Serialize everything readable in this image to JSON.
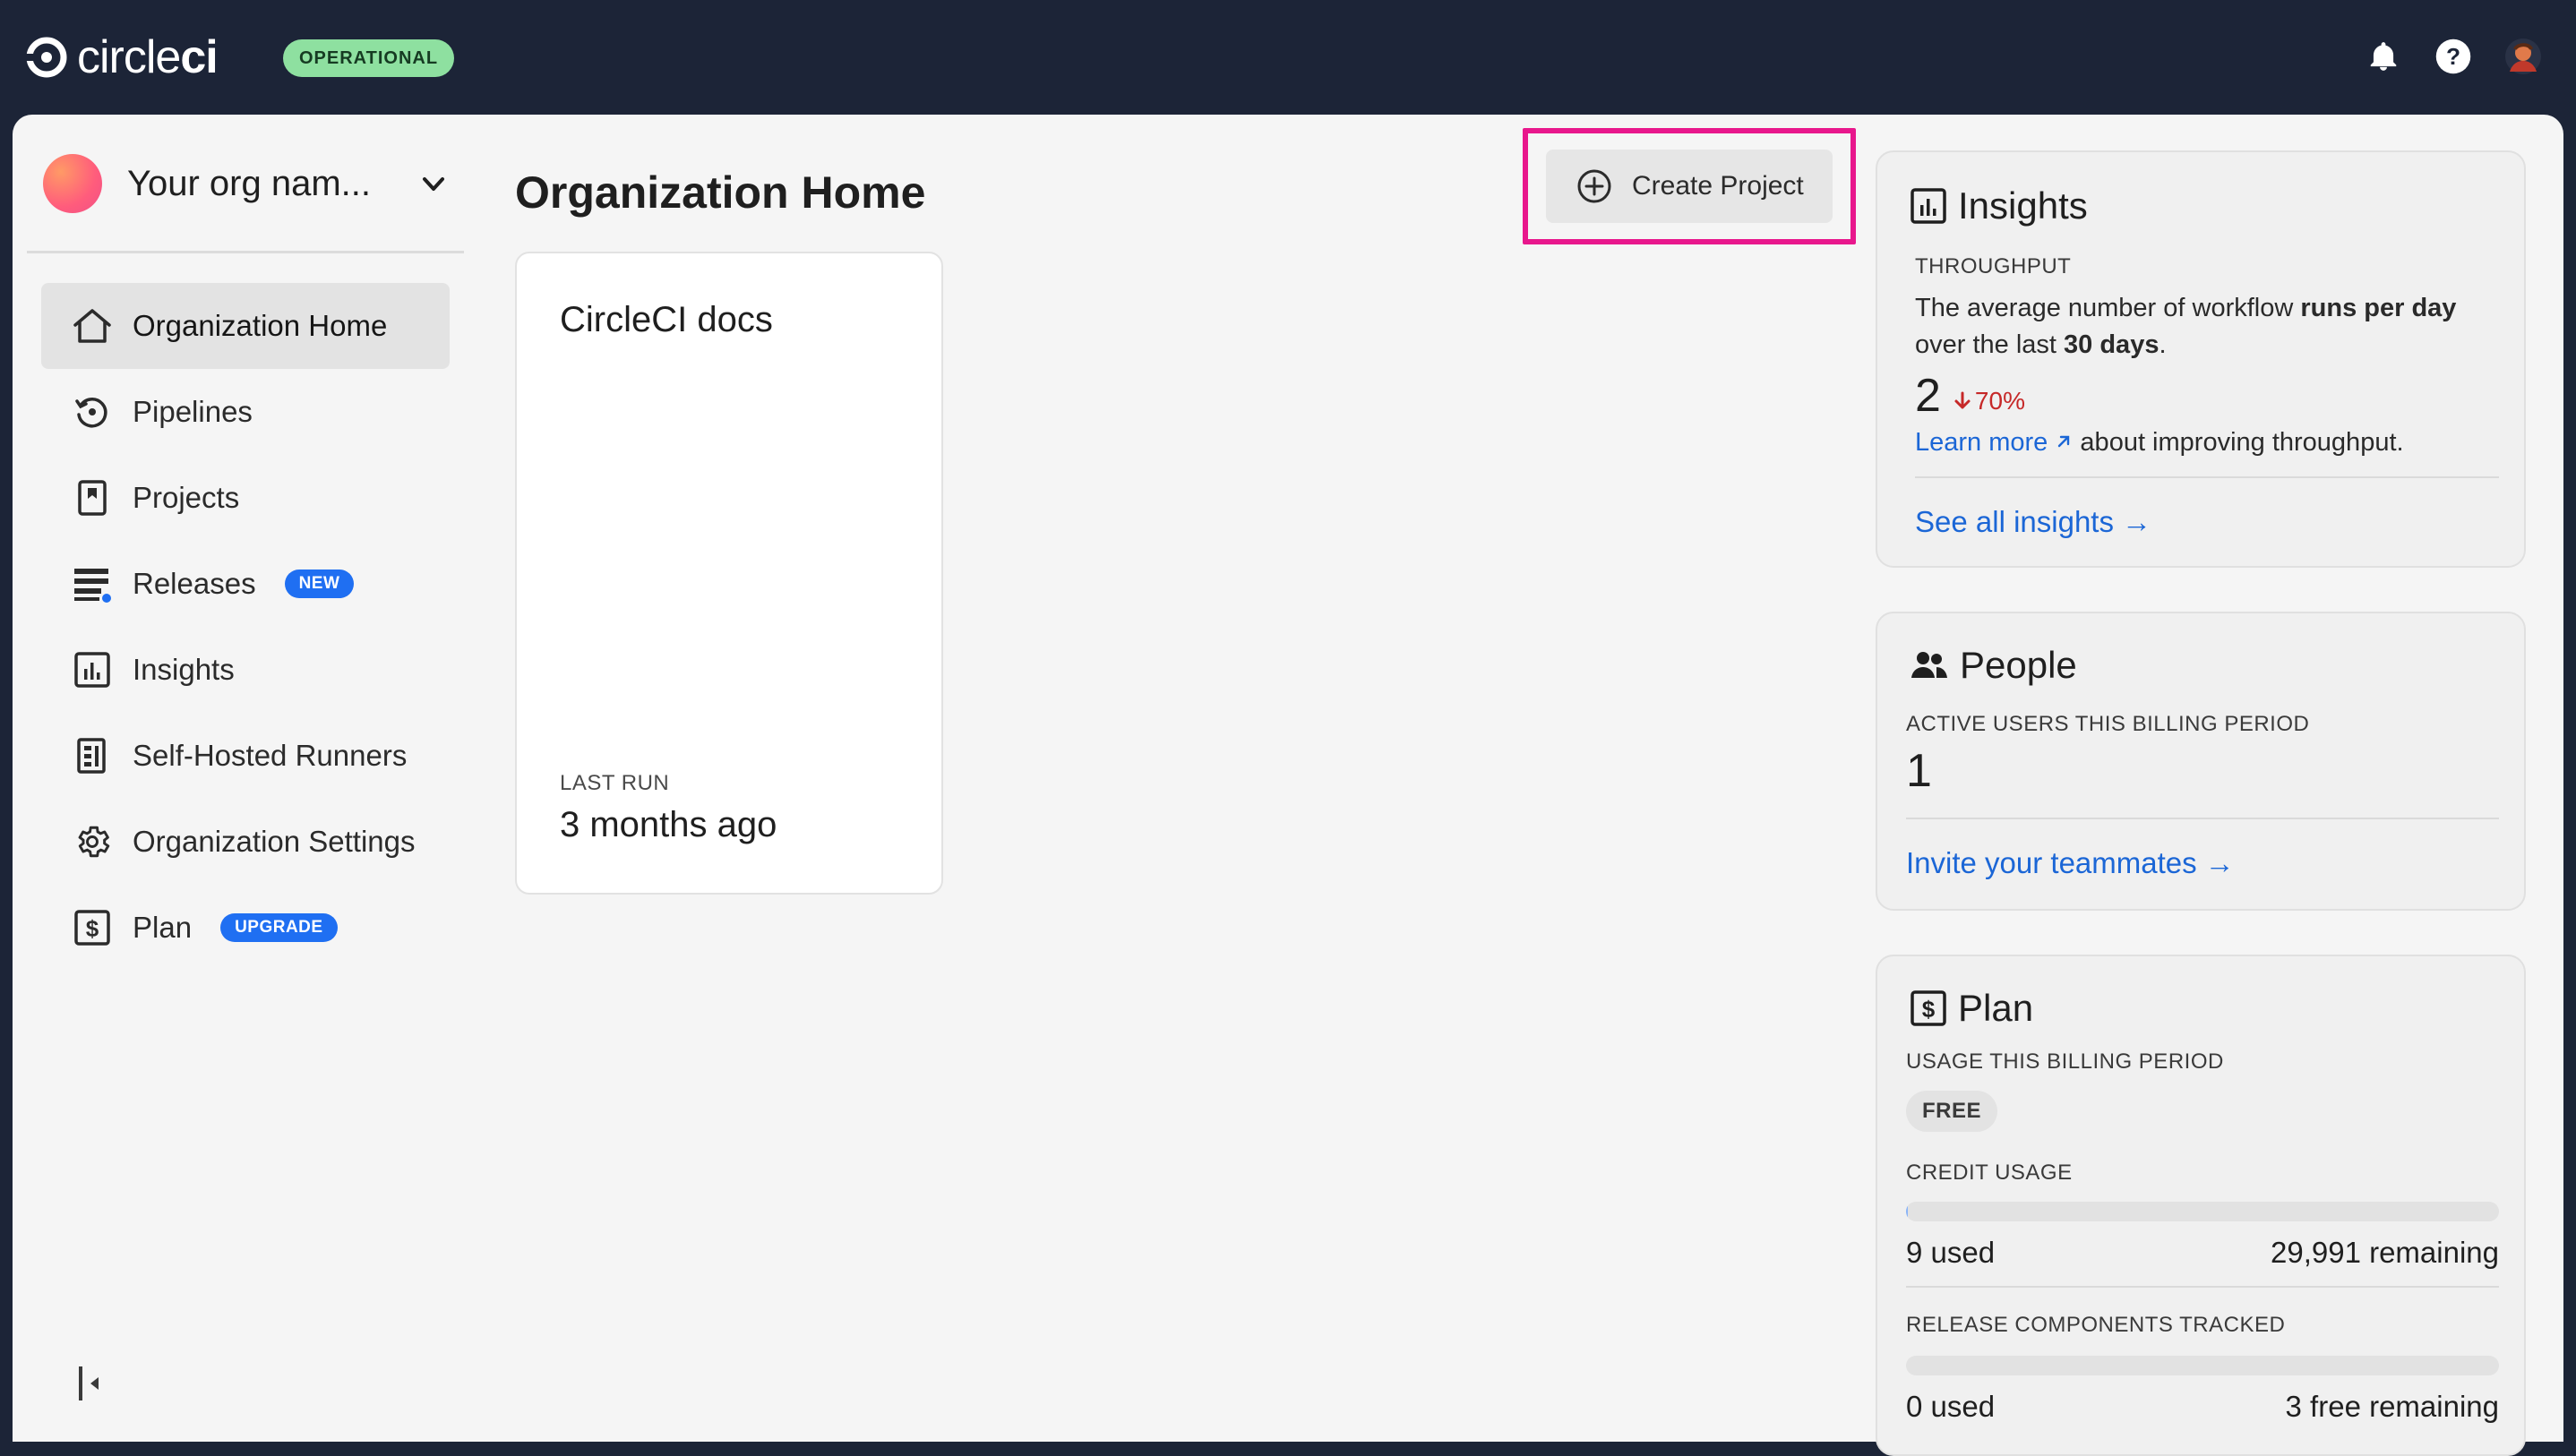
{
  "header": {
    "logo_text_light": "circle",
    "logo_text_bold": "ci",
    "status_badge": "OPERATIONAL",
    "icons": [
      "bell-icon",
      "help-icon",
      "user-avatar"
    ]
  },
  "sidebar": {
    "org_name": "Your org nam...",
    "items": [
      {
        "label": "Organization Home",
        "icon": "home-icon",
        "active": true
      },
      {
        "label": "Pipelines",
        "icon": "pipelines-icon"
      },
      {
        "label": "Projects",
        "icon": "projects-icon"
      },
      {
        "label": "Releases",
        "icon": "releases-icon",
        "badge": "NEW"
      },
      {
        "label": "Insights",
        "icon": "insights-icon"
      },
      {
        "label": "Self-Hosted Runners",
        "icon": "runners-icon"
      },
      {
        "label": "Organization Settings",
        "icon": "gear-icon"
      },
      {
        "label": "Plan",
        "icon": "dollar-icon",
        "badge": "UPGRADE"
      }
    ]
  },
  "main": {
    "title": "Organization Home",
    "create_button": "Create Project",
    "project_card": {
      "name": "CircleCI docs",
      "last_run_label": "LAST RUN",
      "last_run_value": "3 months ago"
    }
  },
  "insights": {
    "title": "Insights",
    "label": "THROUGHPUT",
    "desc_a": "The average number of workflow ",
    "desc_b": "runs per day",
    "desc_c": " over the last ",
    "desc_d": "30 days",
    "desc_e": ".",
    "value": "2",
    "delta": "70%",
    "learn_more": "Learn more",
    "learn_more_suffix": " about improving throughput.",
    "see_all": "See all insights →"
  },
  "people": {
    "title": "People",
    "label": "ACTIVE USERS THIS BILLING PERIOD",
    "value": "1",
    "invite": "Invite your teammates →"
  },
  "plan": {
    "title": "Plan",
    "label": "USAGE THIS BILLING PERIOD",
    "tier": "FREE",
    "credit_label": "CREDIT USAGE",
    "credit_used": "9 used",
    "credit_remaining": "29,991 remaining",
    "credit_fraction": 0.0003,
    "release_label": "RELEASE COMPONENTS TRACKED",
    "release_used": "0 used",
    "release_remaining": "3 free remaining",
    "release_fraction": 0
  },
  "colors": {
    "topbar": "#1c2437",
    "accent": "#1f6ff2",
    "highlight": "#e8178c",
    "status_green": "#8ee0a0",
    "negative": "#c62828"
  }
}
